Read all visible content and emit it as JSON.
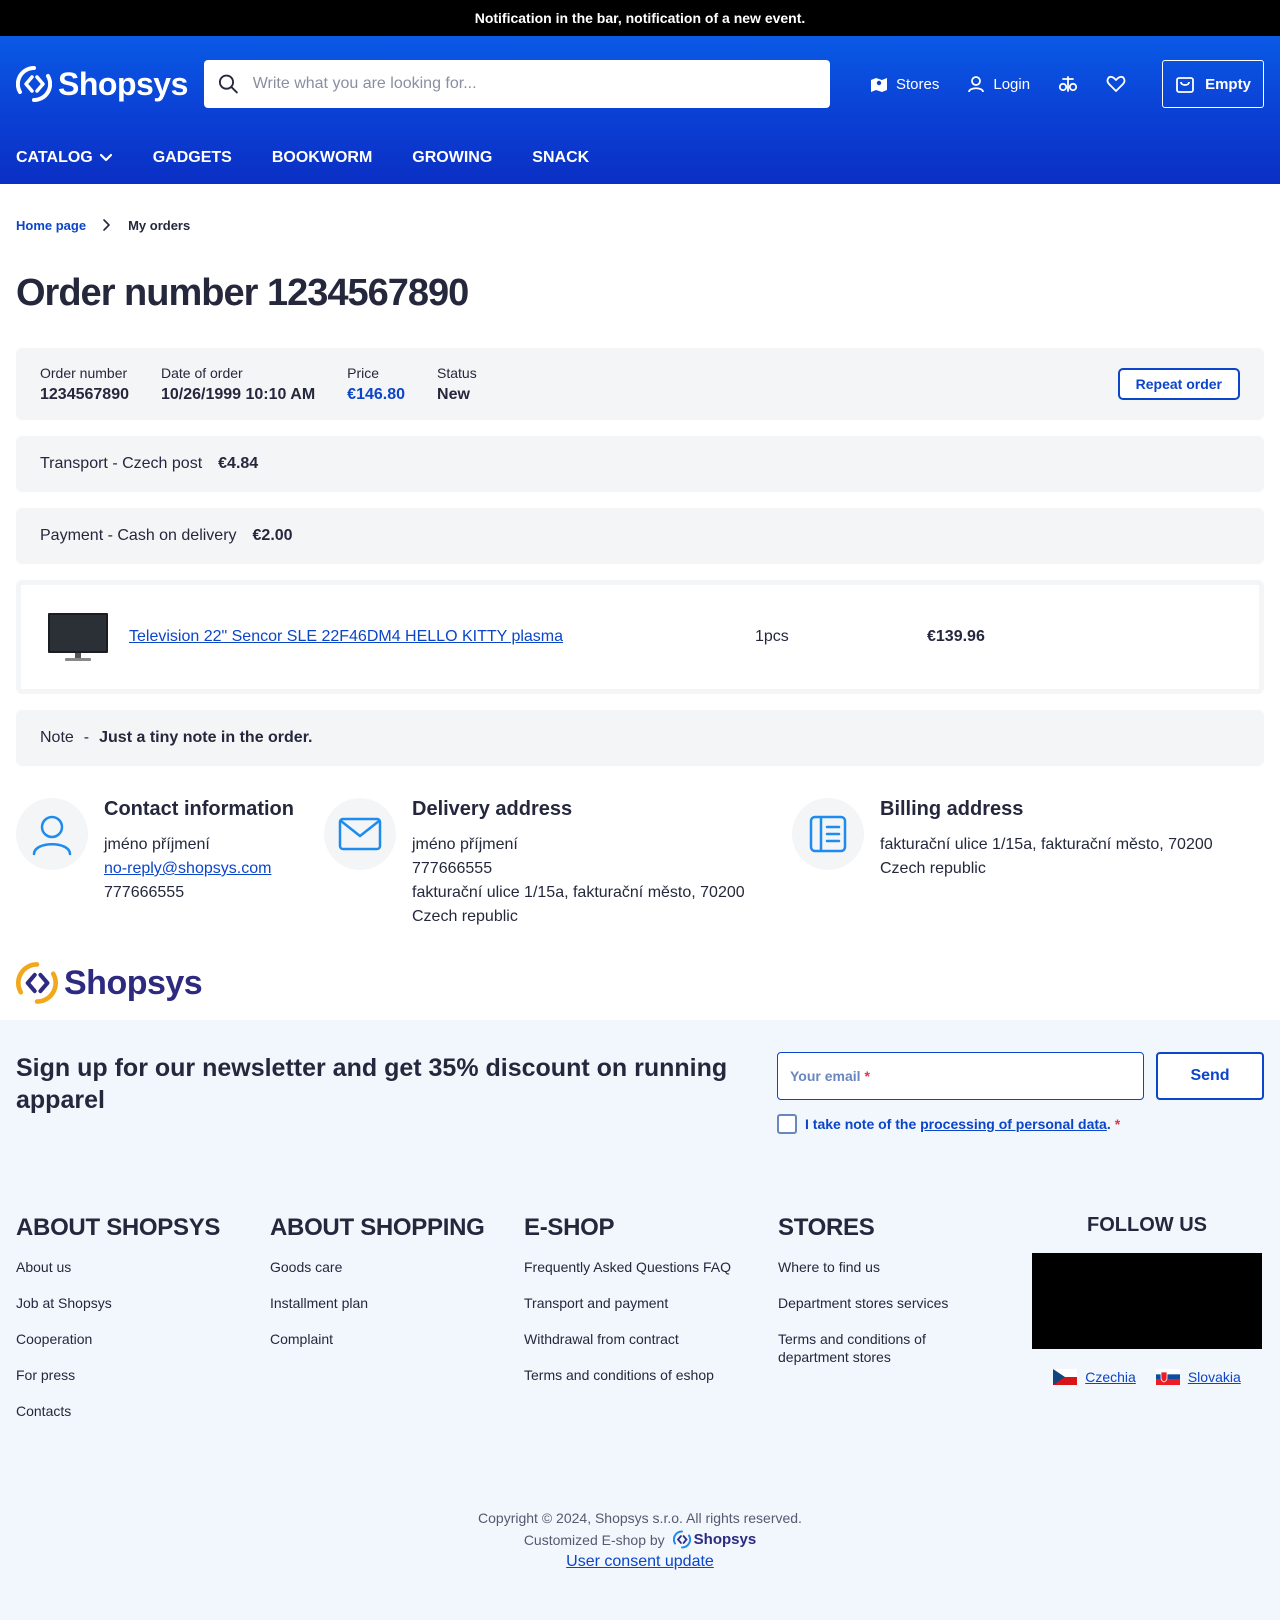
{
  "notification": "Notification in the bar, notification of a new event.",
  "header": {
    "logo": "Shopsys",
    "search_placeholder": "Write what you are looking for...",
    "stores": "Stores",
    "login": "Login",
    "cart": "Empty"
  },
  "nav": [
    {
      "label": "CATALOG"
    },
    {
      "label": "GADGETS"
    },
    {
      "label": "BOOKWORM"
    },
    {
      "label": "GROWING"
    },
    {
      "label": "SNACK"
    }
  ],
  "breadcrumb": {
    "home": "Home page",
    "current": "My orders"
  },
  "page_title": "Order number 1234567890",
  "order": {
    "number_label": "Order number",
    "number": "1234567890",
    "date_label": "Date of order",
    "date": "10/26/1999 10:10 AM",
    "price_label": "Price",
    "price": "€146.80",
    "status_label": "Status",
    "status": "New",
    "repeat": "Repeat order"
  },
  "transport": {
    "label": "Transport - Czech post",
    "amount": "€4.84"
  },
  "payment": {
    "label": "Payment - Cash on delivery",
    "amount": "€2.00"
  },
  "item": {
    "name": "Television 22\" Sencor SLE 22F46DM4 HELLO KITTY plasma",
    "qty": "1pcs",
    "price": "€139.96"
  },
  "note": {
    "label": "Note",
    "sep": "-",
    "text": "Just a tiny note in the order."
  },
  "contact": {
    "title": "Contact information",
    "name": "jméno příjmení",
    "email": "no-reply@shopsys.com",
    "phone": "777666555"
  },
  "delivery": {
    "title": "Delivery address",
    "name": "jméno příjmení",
    "phone": "777666555",
    "street": "fakturační ulice 1/15a, fakturační město, 70200",
    "country": "Czech republic"
  },
  "billing": {
    "title": "Billing address",
    "street": "fakturační ulice 1/15a, fakturační město, 70200",
    "country": "Czech republic"
  },
  "footer_logo": "Shopsys",
  "newsletter": {
    "title": "Sign up for our newsletter and get 35% discount on running apparel",
    "email_placeholder": "Your email",
    "required": "*",
    "send": "Send",
    "consent_prefix": "I take note of the ",
    "consent_link": "processing of personal data",
    "consent_suffix": "."
  },
  "footer_columns": [
    {
      "title": "ABOUT SHOPSYS",
      "links": [
        "About us",
        "Job at Shopsys",
        "Cooperation",
        "For press",
        "Contacts"
      ]
    },
    {
      "title": "ABOUT SHOPPING",
      "links": [
        "Goods care",
        "Installment plan",
        "Complaint"
      ]
    },
    {
      "title": "E-SHOP",
      "links": [
        "Frequently Asked Questions FAQ",
        "Transport and payment",
        "Withdrawal from contract",
        "Terms and conditions of eshop"
      ]
    },
    {
      "title": "STORES",
      "links": [
        "Where to find us",
        "Department stores services",
        "Terms and conditions of department stores"
      ]
    }
  ],
  "follow": {
    "title": "FOLLOW US",
    "countries": [
      "Czechia",
      "Slovakia"
    ]
  },
  "copyright": "Copyright © 2024, Shopsys s.r.o. All rights reserved.",
  "customized": "Customized E-shop by",
  "customized_logo": "Shopsys",
  "consent_update": "User consent update",
  "colors": {
    "brand_blue": "#0b45c9",
    "header_gradient_start": "#0a5ae6",
    "footer_bg": "#f2f6fd",
    "box_bg": "#f4f5f6",
    "required": "#e53050"
  }
}
